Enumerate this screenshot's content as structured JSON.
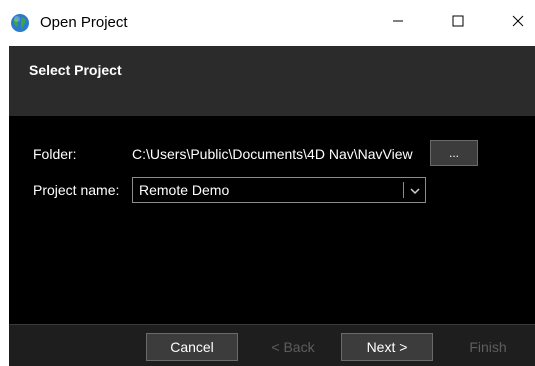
{
  "window": {
    "title": "Open Project",
    "controls": {
      "minimize": "minimize",
      "maximize": "maximize",
      "close": "close"
    }
  },
  "header": {
    "title": "Select Project"
  },
  "form": {
    "folder_label": "Folder:",
    "folder_path": "C:\\Users\\Public\\Documents\\4D Nav\\NavView",
    "browse_label": "...",
    "project_name_label": "Project name:",
    "project_name_value": "Remote Demo"
  },
  "footer": {
    "cancel_label": "Cancel",
    "back_label": "< Back",
    "next_label": "Next >",
    "finish_label": "Finish"
  },
  "colors": {
    "content_bg": "#000000",
    "header_bg": "#2b2b2b",
    "footer_bg": "#1e1e1e",
    "button_bg": "#3c3c3c",
    "disabled_text": "#5e5e5e"
  },
  "icons": {
    "app": "globe-icon",
    "minimize": "minimize-icon",
    "maximize": "maximize-icon",
    "close": "close-icon",
    "dropdown": "chevron-down-icon"
  }
}
